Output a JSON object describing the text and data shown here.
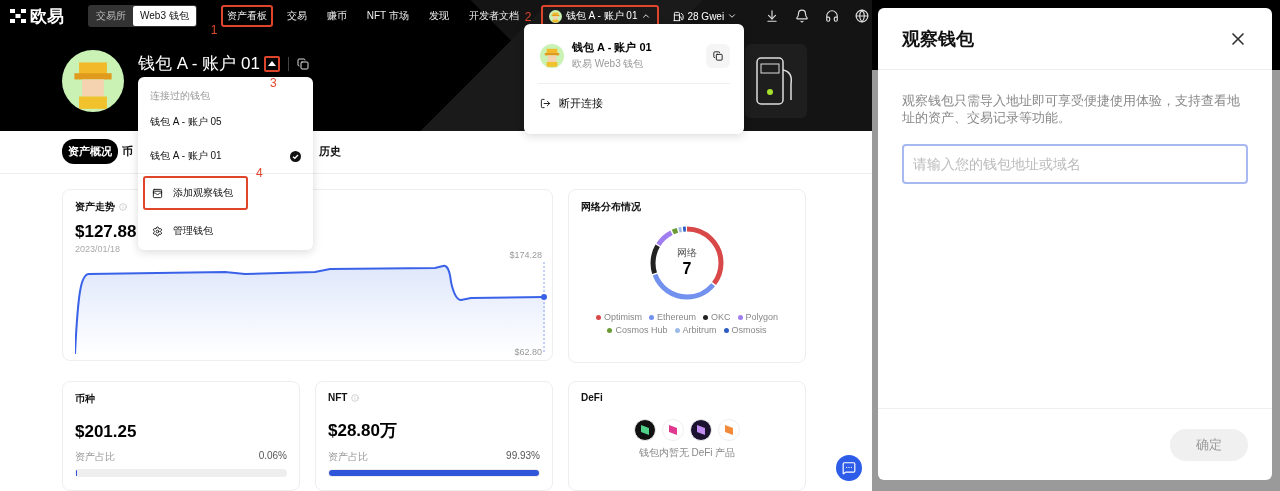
{
  "header": {
    "logo": "欧易",
    "mode_switch": [
      {
        "label": "交易所",
        "selected": false
      },
      {
        "label": "Web3 钱包",
        "selected": true
      }
    ],
    "nav": [
      {
        "label": "资产看板",
        "annotation": "1"
      },
      {
        "label": "交易"
      },
      {
        "label": "赚币"
      },
      {
        "label": "NFT 市场"
      },
      {
        "label": "发现"
      },
      {
        "label": "开发者文档"
      }
    ],
    "wallet_button": {
      "label": "钱包 A - 账户 01",
      "annotation": "2"
    },
    "gas": "28 Gwei"
  },
  "wallet": {
    "name": "钱包 A - 账户 01",
    "annotation": "3"
  },
  "tabs": [
    {
      "label": "资产概况",
      "selected": true
    },
    {
      "label": "币",
      "selected": false
    },
    {
      "label": "历史",
      "selected": false
    }
  ],
  "account_menu": {
    "heading": "连接过的钱包",
    "accounts": [
      {
        "label": "钱包 A - 账户 05",
        "selected": false
      },
      {
        "label": "钱包 A - 账户 01",
        "selected": true
      }
    ],
    "actions": [
      {
        "kind": "add",
        "label": "添加观察钱包",
        "annotation": "4"
      },
      {
        "kind": "manage",
        "label": "管理钱包"
      }
    ]
  },
  "wallet_popover": {
    "name": "钱包 A - 账户 01",
    "subtitle": "欧易 Web3 钱包",
    "action": "断开连接"
  },
  "trend_card": {
    "title": "资产走势",
    "value": "$127.88",
    "date": "2023/01/18",
    "max": "$174.28",
    "min": "$62.80"
  },
  "network_card": {
    "title": "网络分布情况",
    "center_label": "网络",
    "center_value": "7",
    "legend": [
      {
        "label": "Optimism",
        "color": "#d94848"
      },
      {
        "label": "Ethereum",
        "color": "#7391ef"
      },
      {
        "label": "OKC",
        "color": "#222222"
      },
      {
        "label": "Polygon",
        "color": "#a07ef0"
      },
      {
        "label": "Cosmos Hub",
        "color": "#6b9b35"
      },
      {
        "label": "Arbitrum",
        "color": "#9dbbe6"
      },
      {
        "label": "Osmosis",
        "color": "#2d5bc4"
      }
    ]
  },
  "holding_cards": [
    {
      "title": "币种",
      "info": false,
      "value": "$201.25",
      "share_label": "资产占比",
      "share": "0.06%",
      "level": 0.0006
    },
    {
      "title": "NFT",
      "info": true,
      "value": "$28.80万",
      "share_label": "资产占比",
      "share": "99.93%",
      "level": 0.9993
    }
  ],
  "defi_card": {
    "title": "DeFi",
    "empty_text": "钱包内暂无 DeFi 产品"
  },
  "modal": {
    "title": "观察钱包",
    "description": "观察钱包只需导入地址即可享受便捷使用体验，支持查看地址的资产、交易记录等功能。",
    "placeholder": "请输入您的钱包地址或域名",
    "confirm": "确定",
    "confirm_disabled": true
  }
}
